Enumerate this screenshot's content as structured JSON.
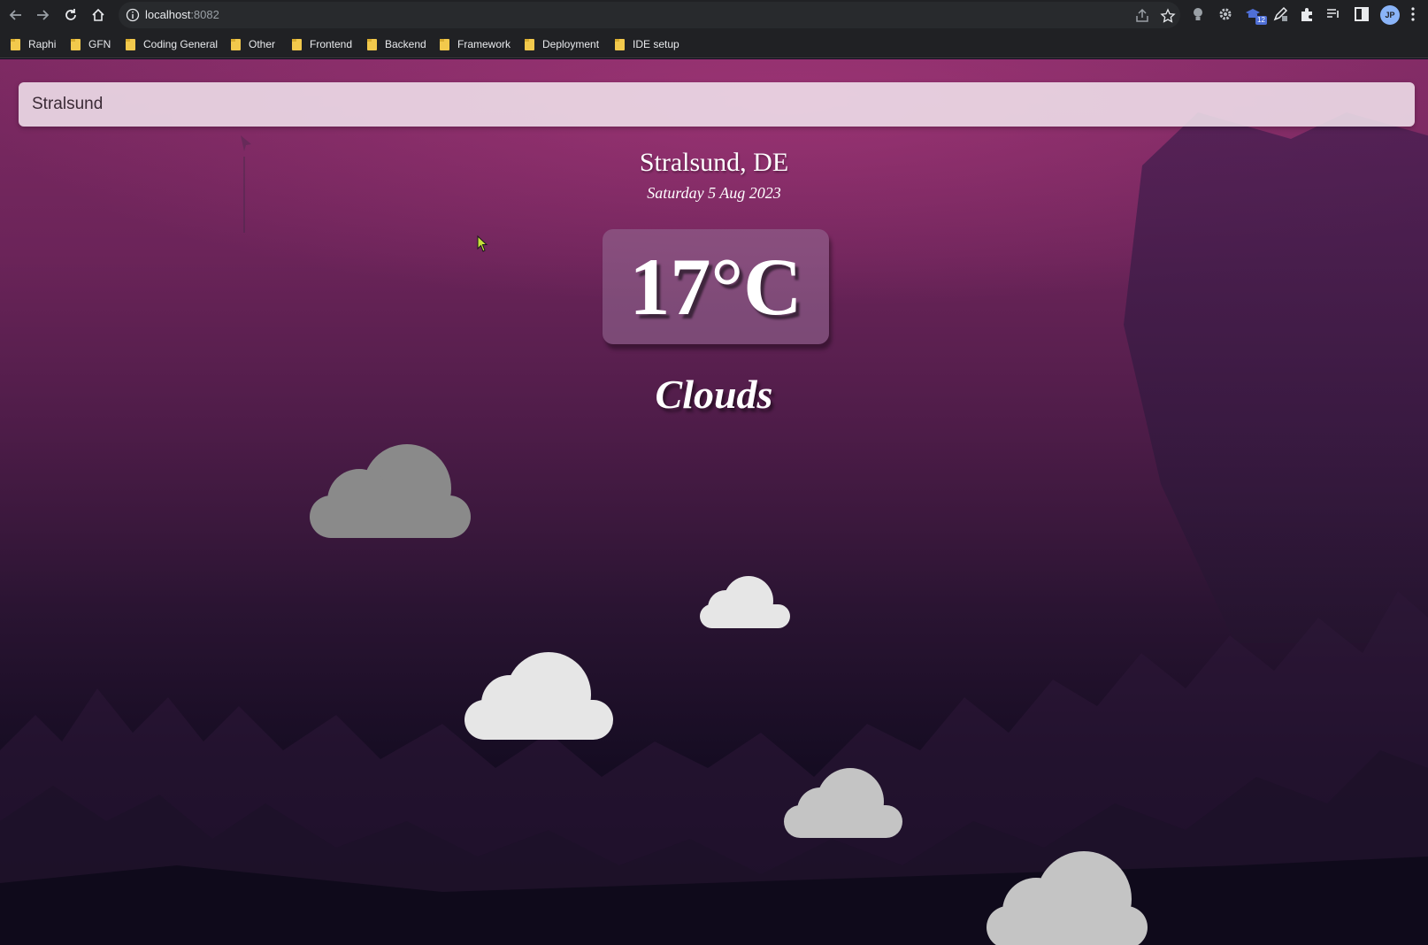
{
  "browser": {
    "url_host": "localhost",
    "url_port": ":8082",
    "avatar_initials": "JP",
    "extension_badge": "12",
    "bookmarks": [
      "Raphi",
      "GFN",
      "Coding General",
      "Other",
      "Frontend",
      "Backend",
      "Framework",
      "Deployment",
      "IDE setup"
    ]
  },
  "app": {
    "search_value": "Stralsund",
    "location": "Stralsund, DE",
    "date": "Saturday 5 Aug 2023",
    "temperature": "17°C",
    "condition": "Clouds"
  },
  "colors": {
    "cloud_dark": "#8a8a8a",
    "cloud_light": "#e6e6e6",
    "cloud_mid": "#c4c4c4"
  }
}
